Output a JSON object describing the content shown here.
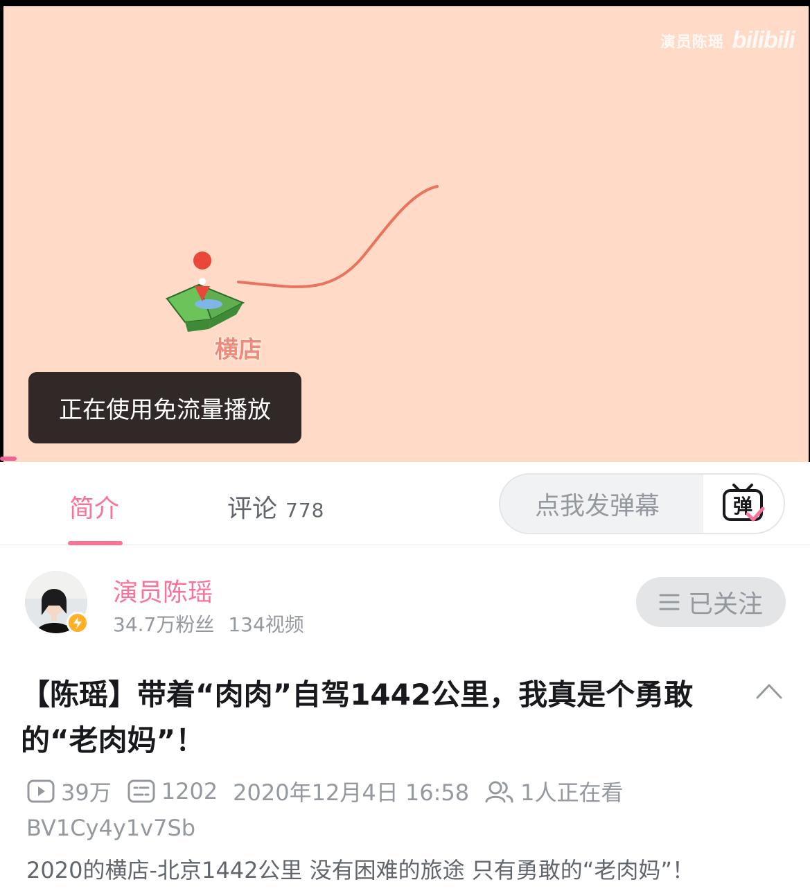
{
  "video": {
    "watermark_name": "演员陈瑶",
    "watermark_logo": "bilibili",
    "map_label": "横店",
    "toast": "正在使用免流量播放"
  },
  "tabs": {
    "intro": "简介",
    "comments": "评论",
    "comments_count": "778"
  },
  "danmaku": {
    "placeholder": "点我发弹幕",
    "toggle_label": "弹"
  },
  "uploader": {
    "name": "演员陈瑶",
    "fans": "34.7万粉丝",
    "videos": "134视频",
    "follow_label": "已关注"
  },
  "video_info": {
    "title": "【陈瑶】带着“肉肉”自驾1442公里，我真是个勇敢的“老肉妈”！",
    "views": "39万",
    "danmaku_count": "1202",
    "publish_time": "2020年12月4日 16:58",
    "watching": "1人正在看",
    "bvid": "BV1Cy4y1v7Sb",
    "description": "2020的横店-北京1442公里 没有困难的旅途 只有勇敢的“老肉妈”！"
  },
  "colors": {
    "accent": "#fb7299",
    "video_bg": "#ffdac6",
    "route": "#e8735f",
    "toast_bg": "#302927"
  }
}
